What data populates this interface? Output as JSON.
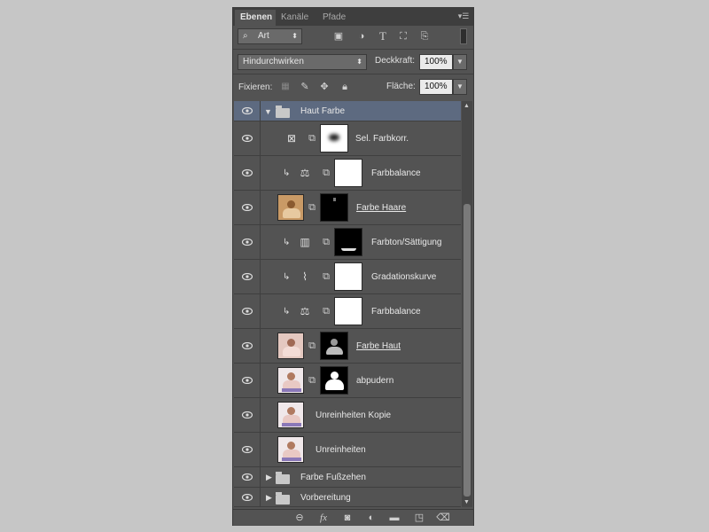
{
  "tabs": [
    "Ebenen",
    "Kanäle",
    "Pfade"
  ],
  "filter": {
    "icon": "search-icon",
    "value": "Art"
  },
  "filter_icons": [
    "image-filter-icon",
    "adjustment-filter-icon",
    "text-filter-icon",
    "shape-filter-icon",
    "smartobject-filter-icon"
  ],
  "blend": {
    "mode": "Hindurchwirken",
    "opacity_label": "Deckkraft:",
    "opacity_value": "100%"
  },
  "lock": {
    "label": "Fixieren:",
    "fill_label": "Fläche:",
    "fill_value": "100%"
  },
  "layers": [
    {
      "name": "Haut Farbe",
      "type": "group-open"
    },
    {
      "name": "Sel. Farbkorr.",
      "type": "adjust",
      "icon": "selective-color-icon"
    },
    {
      "name": "Farbbalance",
      "type": "adjust",
      "icon": "color-balance-icon",
      "clipped": true
    },
    {
      "name": "Farbe Haare",
      "type": "image-mask",
      "underline": true
    },
    {
      "name": "Farbton/Sättigung",
      "type": "adjust",
      "icon": "hue-saturation-icon",
      "clipped": true
    },
    {
      "name": "Gradationskurve",
      "type": "adjust",
      "icon": "curves-icon",
      "clipped": true
    },
    {
      "name": "Farbbalance",
      "type": "adjust",
      "icon": "color-balance-icon",
      "clipped": true
    },
    {
      "name": "Farbe Haut",
      "type": "image-mask",
      "underline": true
    },
    {
      "name": "abpudern",
      "type": "image-mask"
    },
    {
      "name": "Unreinheiten Kopie",
      "type": "image"
    },
    {
      "name": "Unreinheiten",
      "type": "image"
    },
    {
      "name": "Farbe Fußzehen",
      "type": "group-closed"
    },
    {
      "name": "Vorbereitung",
      "type": "group-closed"
    }
  ],
  "bottom_icons": [
    "link-icon",
    "fx-icon",
    "mask-icon",
    "adjustment-icon",
    "new-group-icon",
    "new-layer-icon",
    "trash-icon"
  ],
  "colors": {
    "panel": "#535353",
    "tabbar": "#3e3e3e",
    "selected_group": "#5d6a80",
    "page_bg": "#c6c6c6"
  }
}
